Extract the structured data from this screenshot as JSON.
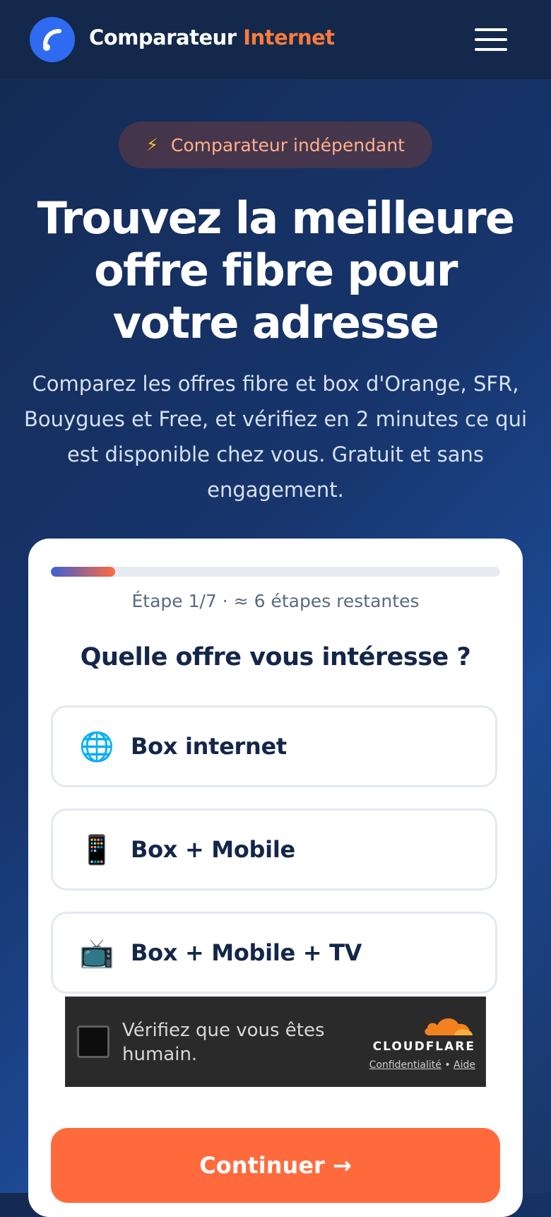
{
  "header": {
    "brand_part1": "Comparateur",
    "brand_part2": "Internet",
    "menu_icon": "hamburger-menu-icon"
  },
  "hero": {
    "badge_icon": "⚡",
    "badge_label": "Comparateur indépendant",
    "title": "Trouvez la meilleure offre fibre pour votre adresse",
    "subtitle": "Comparez les offres fibre et box d'Orange, SFR, Bouygues et Free, et vérifiez en 2 minutes ce qui est disponible chez vous. Gratuit et sans engagement."
  },
  "form": {
    "progress": {
      "current_step": 1,
      "total_steps": 7,
      "fraction": 0.143
    },
    "step_text": "Étape 1/7 · ≈ 6 étapes restantes",
    "question": "Quelle offre vous intéresse ?",
    "options": [
      {
        "icon": "🌐",
        "icon_name": "globe-icon",
        "label": "Box internet"
      },
      {
        "icon": "📱",
        "icon_name": "mobile-phone-icon",
        "label": "Box + Mobile"
      },
      {
        "icon": "📺",
        "icon_name": "television-icon",
        "label": "Box + Mobile + TV"
      }
    ],
    "continue_label": "Continuer →"
  },
  "captcha": {
    "text": "Vérifiez que vous êtes humain.",
    "brand": "CLOUDFLARE",
    "privacy_link": "Confidentialité",
    "separator": "•",
    "help_link": "Aide"
  },
  "colors": {
    "accent": "#ff6a3d",
    "brand_blue": "#2f6bf0",
    "header_bg": "#13284a",
    "navy_text": "#14274a"
  }
}
